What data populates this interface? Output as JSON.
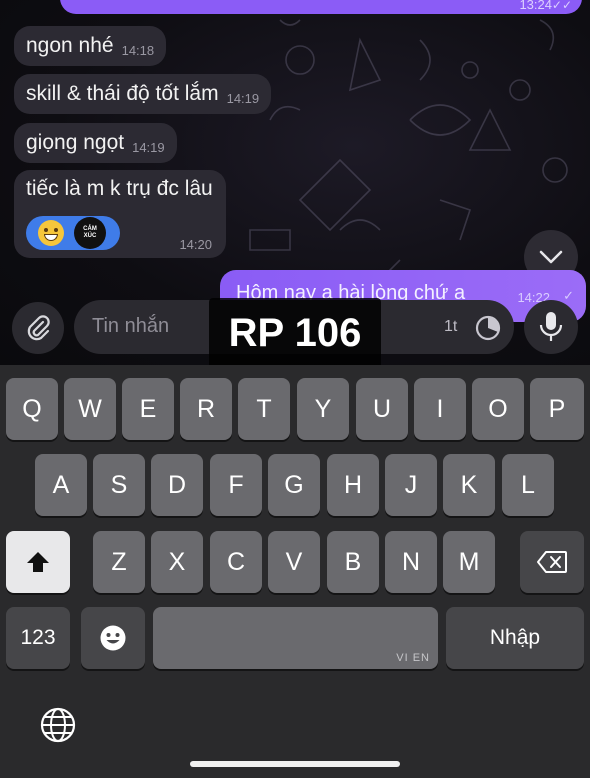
{
  "chat": {
    "top_outgoing": {
      "time": "13:24",
      "ticks": "✓✓"
    },
    "incoming": [
      {
        "text": "ngon nhé",
        "time": "14:18"
      },
      {
        "text": "skill & thái độ tốt lắm",
        "time": "14:19"
      },
      {
        "text": "giọng ngọt",
        "time": "14:19"
      },
      {
        "text": "tiếc là m k trụ đc lâu",
        "time": "14:20"
      }
    ],
    "reaction": {
      "emoji": "grinning-face-icon",
      "sticker_line1": "CẢM",
      "sticker_line2": "XÚC"
    },
    "outgoing": {
      "text": "Hôm nay a hài lòng chứ a",
      "time": "14:22",
      "ticks": "✓"
    }
  },
  "input_bar": {
    "placeholder": "Tin nhắn",
    "timer_label": "1t"
  },
  "overlay": {
    "label": "RP 106"
  },
  "keyboard": {
    "row1": [
      "Q",
      "W",
      "E",
      "R",
      "T",
      "Y",
      "U",
      "I",
      "O",
      "P"
    ],
    "row2": [
      "A",
      "S",
      "D",
      "F",
      "G",
      "H",
      "J",
      "K",
      "L"
    ],
    "row3": [
      "Z",
      "X",
      "C",
      "V",
      "B",
      "N",
      "M"
    ],
    "numbers_key": "123",
    "space_lang": "VI EN",
    "return_key": "Nhập"
  },
  "colors": {
    "outgoing_bubble": "#8b5cf6",
    "incoming_bubble": "#2c2a33",
    "reaction_pill": "#3f7ce9"
  }
}
